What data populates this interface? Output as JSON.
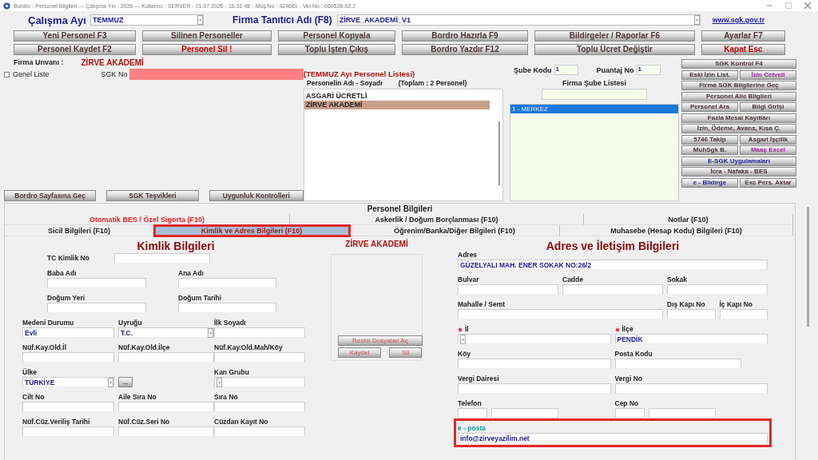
{
  "window": {
    "title": "Bordro - Personel Bilgileri  ---  Çalışma Yılı : 2026  ---  Kullanıcı : SERVER - 21.07.2026 - 16:31:48 - Müş.No : 424681 - Ver.No : 060526-02.2"
  },
  "header": {
    "month_label": "Çalışma Ayı",
    "month": "TEMMUZ",
    "company_label": "Firma Tanıtıcı Adı (F8)",
    "company": "ZİRVE_AKADEMİ_V1",
    "link": "www.sgk.gov.tr"
  },
  "toolbar": [
    [
      {
        "label": "Yeni Personel F3",
        "color": "#4a3434"
      },
      {
        "label": "Silinen Personeller",
        "color": "#4a3434"
      },
      {
        "label": "Personel Kopyala",
        "color": "#4a3434"
      },
      {
        "label": "Bordro Hazırla F9",
        "color": "#4a3434"
      },
      {
        "label": "Bildirgeler / Raporlar F6",
        "color": "#4a3434"
      },
      {
        "label": "Ayarlar F7",
        "color": "#4a3434"
      }
    ],
    [
      {
        "label": "Personel Kaydet F2",
        "color": "#4a3434"
      },
      {
        "label": "Personel Sil !",
        "color": "#c00000"
      },
      {
        "label": "Toplu İşten Çıkış",
        "color": "#4a3434"
      },
      {
        "label": "Bordro Yazdır F12",
        "color": "#4a3434"
      },
      {
        "label": "Toplu Ücret Değiştir",
        "color": "#4a3434"
      },
      {
        "label": "Kapat Esc",
        "color": "#c00000"
      }
    ]
  ],
  "firm": {
    "label": "Firma Unvanı :",
    "name": "ZİRVE AKADEMİ"
  },
  "general_list": {
    "label": "Genel Liste",
    "checked": false
  },
  "sgk_no": {
    "label": "SGK No"
  },
  "bottom_buttons": [
    "Bordro Sayfasına Geç",
    "SGK Teşvikleri",
    "Uygunluk Kontrolleri"
  ],
  "personnel_list": {
    "title": "(TEMMUZ Ayı Personel Listesi)",
    "column": "Personelin Adı - Soyadı",
    "total": "(Toplam : 2 Personel)",
    "items": [
      {
        "name": "ASGARİ ÜCRETLİ",
        "selected": false
      },
      {
        "name": "ZİRVE AKADEMİ",
        "selected": true
      }
    ]
  },
  "branch": {
    "code_label": "Şube Kodu",
    "code": "1",
    "timesheet_label": "Puantaj No",
    "timesheet": "1",
    "list_title": "Firma Şube Listesi",
    "items": [
      {
        "name": "1 - MERKEZ",
        "selected": true
      }
    ]
  },
  "side_buttons": [
    [
      {
        "label": "SGK Kontrol F4",
        "color": "#4a3434"
      }
    ],
    [
      {
        "label": "Eski İzin List.",
        "color": "#4a3434"
      },
      {
        "label": "İzin Cetveli",
        "color": "#a020a0"
      }
    ],
    [
      {
        "label": "Firma SGK Bilgilerine Geç",
        "color": "#4a3434"
      }
    ],
    [
      {
        "label": "Personel Aile Bilgileri",
        "color": "#4a3434"
      }
    ],
    [
      {
        "label": "Personel Ara",
        "color": "#4a3434"
      },
      {
        "label": "Bilgi Girişi",
        "color": "#4a3434"
      }
    ],
    [
      {
        "label": "Fazla Mesai Kayıtları",
        "color": "#4a3434"
      }
    ],
    [
      {
        "label": "İzin, Ödeme, Avans, Kısa Ç.",
        "color": "#4a3434"
      }
    ],
    [
      {
        "label": "5746 Takip",
        "color": "#4a3434"
      },
      {
        "label": "Asgari İşçilik",
        "color": "#4a3434"
      }
    ],
    [
      {
        "label": "MuhSgk B.",
        "color": "#4a3434"
      },
      {
        "label": "Maaş Excel",
        "color": "#a020a0"
      }
    ],
    [
      {
        "label": "E-SGK Uygulamaları",
        "color": "#1a1aa0"
      }
    ],
    [
      {
        "label": "İcra - Nafaka - BES",
        "color": "#4a3434"
      }
    ],
    [
      {
        "label": "e - Bildirge",
        "color": "#1a1aa0"
      },
      {
        "label": "Exc Pers. Aktar",
        "color": "#4a3434"
      }
    ]
  ],
  "details": {
    "title": "Personel Bilgileri",
    "tab_rows": [
      [
        {
          "label": "Otomatik BES / Özel Sigorta (F10)",
          "alert": true,
          "selected": false
        },
        {
          "label": "Askerlik / Doğum Borçlanması (F10)",
          "alert": false,
          "selected": false
        },
        {
          "label": "Notlar (F10)",
          "alert": false,
          "selected": false
        }
      ],
      [
        {
          "label": "Sicil Bilgileri (F10)",
          "alert": false,
          "selected": false
        },
        {
          "label": "Kimlik ve Adres Bilgileri (F10)",
          "alert": false,
          "selected": true
        },
        {
          "label": "Öğrenim/Banka/Diğer Bilgileri (F10)",
          "alert": false,
          "selected": false
        },
        {
          "label": "Muhasebe (Hesap Kodu) Bilgileri (F10)",
          "alert": false,
          "selected": false
        }
      ]
    ],
    "identity": {
      "title": "Kimlik Bilgileri",
      "fields": [
        {
          "label": "TC Kimlik No",
          "kind": "inline"
        },
        {
          "label": "Baba Adı",
          "kind": "text"
        },
        {
          "label": "Ana Adı",
          "kind": "text"
        },
        {
          "label": "Doğum Yeri",
          "kind": "text"
        },
        {
          "label": "Doğum Tarihi",
          "kind": "text"
        },
        {
          "label": "Medeni Durumu",
          "kind": "text",
          "value": "Evli"
        },
        {
          "label": "Uyruğu",
          "kind": "select",
          "value": "T.C."
        },
        {
          "label": "İlk Soyadı",
          "kind": "text"
        },
        {
          "label": "Nüf.Kay.Old.İl",
          "kind": "text"
        },
        {
          "label": "Nüf.Kay.Old.İlçe",
          "kind": "text"
        },
        {
          "label": "Nüf.Kay.Old.Mah/Köy",
          "kind": "text"
        },
        {
          "label": "Ülke",
          "kind": "select",
          "value": "TÜRKİYE",
          "button": "..."
        },
        {
          "label": "Kan Grubu",
          "kind": "select"
        },
        {
          "label": "Cilt No",
          "kind": "text"
        },
        {
          "label": "Aile Sıra No",
          "kind": "text"
        },
        {
          "label": "Sıra No",
          "kind": "text"
        },
        {
          "label": "Nüf.Cüz.Veriliş Tarihi",
          "kind": "text"
        },
        {
          "label": "Nüf.Cüz.Seri No",
          "kind": "text"
        },
        {
          "label": "Cüzdan Kayıt No",
          "kind": "text"
        }
      ]
    },
    "photo": {
      "name": "ZİRVE AKADEMİ",
      "open_button": "Resim Dosyaları Aç",
      "save_button": "Kaydet",
      "delete_button": "Sil"
    },
    "address": {
      "title": "Adres ve İletişim Bilgileri",
      "fields": [
        {
          "label": "Adres",
          "kind": "text",
          "value": "GÜZELYALI MAH. ENER SOKAK NO:26/2",
          "required": false,
          "highlighted": false
        },
        {
          "label": "Bulvar",
          "kind": "text",
          "required": false,
          "highlighted": false
        },
        {
          "label": "Cadde",
          "kind": "text",
          "required": false,
          "highlighted": false
        },
        {
          "label": "Sokak",
          "kind": "text",
          "required": false,
          "highlighted": false
        },
        {
          "label": "Mahalle / Semt",
          "kind": "text",
          "required": false,
          "highlighted": false
        },
        {
          "label": "Dış Kapı No",
          "kind": "text",
          "required": false,
          "highlighted": false
        },
        {
          "label": "İç Kapı No",
          "kind": "text",
          "required": false,
          "highlighted": false
        },
        {
          "label": "İl",
          "kind": "select",
          "required": true,
          "highlighted": false
        },
        {
          "label": "İlçe",
          "kind": "text",
          "value": "PENDİK",
          "required": true,
          "highlighted": false
        },
        {
          "label": "Köy",
          "kind": "text",
          "required": false,
          "highlighted": false
        },
        {
          "label": "Posta Kodu",
          "kind": "text",
          "required": false,
          "highlighted": false
        },
        {
          "label": "Vergi Dairesi",
          "kind": "text",
          "required": false,
          "highlighted": false
        },
        {
          "label": "Vergi No",
          "kind": "text",
          "required": false,
          "highlighted": false
        },
        {
          "label": "Telefon",
          "kind": "split",
          "required": false,
          "highlighted": false
        },
        {
          "label": "Cep No",
          "kind": "split",
          "required": false,
          "highlighted": false
        },
        {
          "label": "e - posta",
          "kind": "text",
          "value": "info@zirveyazilim.net",
          "required": false,
          "highlighted": true
        }
      ]
    }
  }
}
